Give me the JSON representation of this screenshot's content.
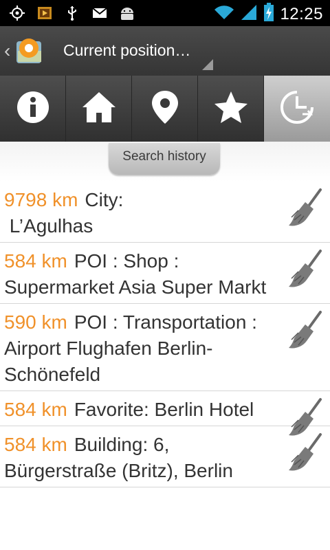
{
  "status_bar": {
    "time": "12:25",
    "icons": [
      "gps-icon",
      "media-icon",
      "usb-icon",
      "gmail-icon",
      "android-icon",
      "wifi-icon",
      "signal-icon",
      "battery-charging-icon"
    ]
  },
  "action_bar": {
    "title": "Current position…",
    "app_icon": "osmand-app-icon"
  },
  "tabs": [
    {
      "name": "info-tab",
      "icon": "info-icon",
      "active": false
    },
    {
      "name": "home-tab",
      "icon": "home-icon",
      "active": false
    },
    {
      "name": "location-tab",
      "icon": "map-pin-icon",
      "active": false
    },
    {
      "name": "favorites-tab",
      "icon": "star-icon",
      "active": false
    },
    {
      "name": "history-tab",
      "icon": "history-icon",
      "active": true
    }
  ],
  "section_title": "Search history",
  "history": [
    {
      "distance": "9798 km",
      "text": "City:\n L’Agulhas"
    },
    {
      "distance": "584 km",
      "text": "POI : Shop : Supermarket Asia Super Markt"
    },
    {
      "distance": "590 km",
      "text": "POI : Transportation : Airport Flughafen Berlin-Schönefeld"
    },
    {
      "distance": "584 km",
      "text": "Favorite: Berlin Hotel"
    },
    {
      "distance": "584 km",
      "text": "Building: 6, Bürgerstraße (Britz), Berlin"
    }
  ],
  "colors": {
    "accent": "#f0912a",
    "actionbar": "#3d3d3d",
    "tab_active": "#b5b5b5"
  }
}
